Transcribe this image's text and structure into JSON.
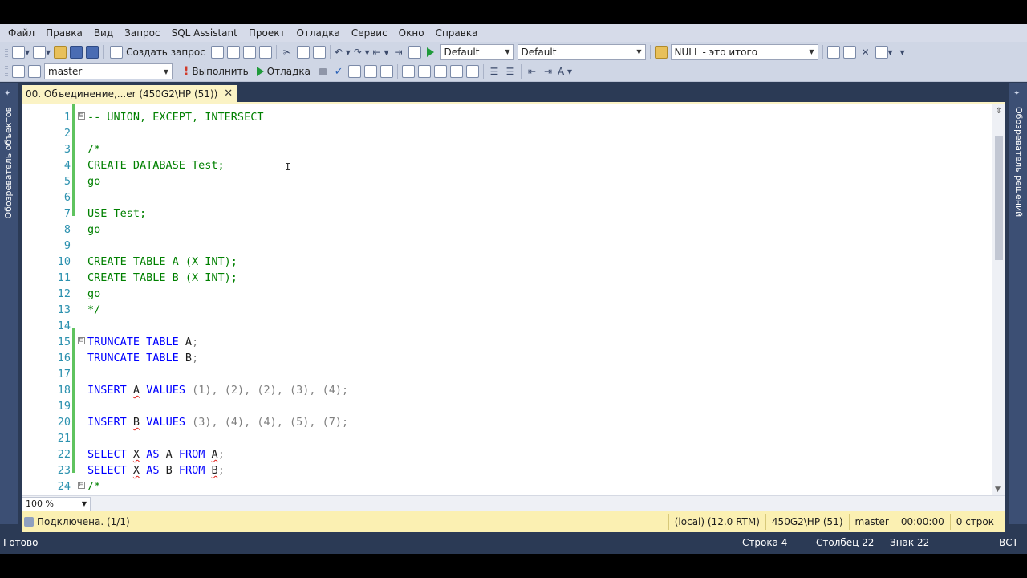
{
  "menu": [
    "Файл",
    "Правка",
    "Вид",
    "Запрос",
    "SQL Assistant",
    "Проект",
    "Отладка",
    "Сервис",
    "Окно",
    "Справка"
  ],
  "toolbar1": {
    "new_query_label": "Создать запрос",
    "solution_config": "Default",
    "platform": "Default",
    "search_combo": "NULL - это итого"
  },
  "toolbar2": {
    "database": "master",
    "execute_label": "Выполнить",
    "debug_label": "Отладка"
  },
  "side_panels": {
    "left": "Обозреватель объектов",
    "right": "Обозреватель решений"
  },
  "tab": {
    "title": "00. Объединение,...er (450G2\\HP (51))",
    "close": "✕"
  },
  "code_lines": [
    {
      "n": "1",
      "fold": "⊟"
    },
    {
      "n": "2"
    },
    {
      "n": "3"
    },
    {
      "n": "4"
    },
    {
      "n": "5"
    },
    {
      "n": "6"
    },
    {
      "n": "7"
    },
    {
      "n": "8"
    },
    {
      "n": "9"
    },
    {
      "n": "10"
    },
    {
      "n": "11"
    },
    {
      "n": "12"
    },
    {
      "n": "13"
    },
    {
      "n": "14"
    },
    {
      "n": "15",
      "fold": "⊟"
    },
    {
      "n": "16"
    },
    {
      "n": "17"
    },
    {
      "n": "18"
    },
    {
      "n": "19"
    },
    {
      "n": "20"
    },
    {
      "n": "21"
    },
    {
      "n": "22"
    },
    {
      "n": "23"
    },
    {
      "n": "24",
      "fold": "⊟"
    }
  ],
  "code": {
    "l1": "-- UNION, EXCEPT, INTERSECT",
    "l3": "/*",
    "l4": "CREATE DATABASE Test;",
    "l5": "go",
    "l7": "USE Test;",
    "l8": "go",
    "l10": "CREATE TABLE A (X INT);",
    "l11": "CREATE TABLE B (X INT);",
    "l12": "go",
    "l13": "*/",
    "l15_kw": "TRUNCATE TABLE",
    "l15_id": " A",
    "l16_kw": "TRUNCATE TABLE",
    "l16_id": " B",
    "semi": ";",
    "insert": "INSERT",
    "values": "VALUES",
    "a": "A",
    "b": "B",
    "l18_vals": "(1), (2), (2), (3), (4);",
    "l20_vals": "(3), (4), (4), (5), (7);",
    "select": "SELECT",
    "x": "X",
    "as": "AS",
    "from": "FROM",
    "l24": "/*"
  },
  "zoom": "100 %",
  "query_status": {
    "connected": "Подключена. (1/1)",
    "server": "(local) (12.0 RTM)",
    "user": "450G2\\HP (51)",
    "db": "master",
    "time": "00:00:00",
    "rows": "0 строк"
  },
  "statusbar": {
    "ready": "Готово",
    "line": "Строка 4",
    "col": "Столбец 22",
    "char": "Знак 22",
    "mode": "ВСТ"
  }
}
